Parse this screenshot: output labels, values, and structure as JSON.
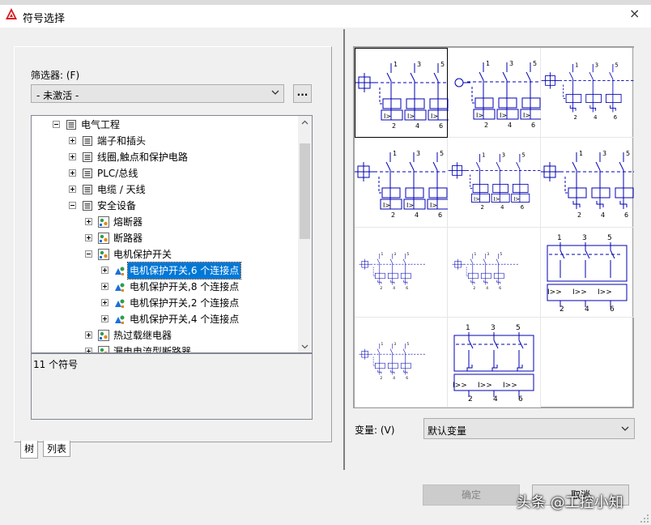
{
  "window": {
    "title": "符号选择",
    "close_label": "×"
  },
  "filter": {
    "label": "筛选器: (F)",
    "value": "- 未激活 -",
    "browse_label": "..."
  },
  "tree": {
    "items": [
      {
        "label": "电气工程",
        "level": 1,
        "state": "open",
        "icon": "folder-icon"
      },
      {
        "label": "端子和插头",
        "level": 2,
        "state": "closed",
        "icon": "folder-icon"
      },
      {
        "label": "线圈,触点和保护电路",
        "level": 2,
        "state": "closed",
        "icon": "folder-icon"
      },
      {
        "label": "PLC/总线",
        "level": 2,
        "state": "closed",
        "icon": "folder-icon"
      },
      {
        "label": "电缆 / 天线",
        "level": 2,
        "state": "closed",
        "icon": "folder-icon"
      },
      {
        "label": "安全设备",
        "level": 2,
        "state": "open",
        "icon": "folder-icon"
      },
      {
        "label": "熔断器",
        "level": 3,
        "state": "closed",
        "icon": "symbol-group-icon"
      },
      {
        "label": "断路器",
        "level": 3,
        "state": "closed",
        "icon": "symbol-group-icon"
      },
      {
        "label": "电机保护开关",
        "level": 3,
        "state": "open",
        "icon": "symbol-group-icon"
      },
      {
        "label": "电机保护开关,6 个连接点",
        "level": 4,
        "state": "closed",
        "icon": "symbol-icon",
        "selected": true
      },
      {
        "label": "电机保护开关,8 个连接点",
        "level": 4,
        "state": "closed",
        "icon": "symbol-icon"
      },
      {
        "label": "电机保护开关,2 个连接点",
        "level": 4,
        "state": "closed",
        "icon": "symbol-icon"
      },
      {
        "label": "电机保护开关,4 个连接点",
        "level": 4,
        "state": "closed",
        "icon": "symbol-icon"
      },
      {
        "label": "热过载继电器",
        "level": 3,
        "state": "closed",
        "icon": "symbol-group-icon"
      },
      {
        "label": "漏电电流型断路器",
        "level": 3,
        "state": "closed",
        "icon": "symbol-group-icon"
      }
    ]
  },
  "status": {
    "text": "11 个符号"
  },
  "tabs": [
    {
      "label": "树",
      "active": true
    },
    {
      "label": "列表",
      "active": false
    }
  ],
  "preview": {
    "symbols": [
      {
        "variant": "full",
        "selected": true,
        "terminals_top": [
          "1",
          "3",
          "5"
        ],
        "terminals_bottom": [
          "2",
          "4",
          "6"
        ],
        "trip": "I>"
      },
      {
        "variant": "full-motor",
        "selected": false,
        "terminals_top": [
          "1",
          "3",
          "5"
        ],
        "terminals_bottom": [
          "2",
          "4",
          "6"
        ],
        "trip": "I>"
      },
      {
        "variant": "compact",
        "selected": false,
        "terminals_top": [
          "1",
          "3",
          "5"
        ],
        "terminals_bottom": [
          "2",
          "4",
          "6"
        ],
        "trip": ""
      },
      {
        "variant": "full",
        "selected": false,
        "terminals_top": [
          "1",
          "3",
          "5"
        ],
        "terminals_bottom": [
          "2",
          "4",
          "6"
        ],
        "trip": "I>"
      },
      {
        "variant": "compact",
        "selected": false,
        "terminals_top": [
          "1",
          "3",
          "5"
        ],
        "terminals_bottom": [
          "2",
          "4",
          "6"
        ],
        "trip": "I>"
      },
      {
        "variant": "thermal",
        "selected": false,
        "terminals_top": [
          "1",
          "3",
          "5"
        ],
        "terminals_bottom": [
          "2",
          "4",
          "6"
        ],
        "trip": ""
      },
      {
        "variant": "mini",
        "selected": false,
        "terminals_top": [
          "1",
          "3",
          "5"
        ],
        "terminals_bottom": [
          "2",
          "4",
          "6"
        ],
        "trip": ""
      },
      {
        "variant": "mini",
        "selected": false,
        "terminals_top": [
          "1",
          "3",
          "5"
        ],
        "terminals_bottom": [
          "2",
          "4",
          "6"
        ],
        "trip": ""
      },
      {
        "variant": "large",
        "selected": false,
        "terminals_top": [
          "1",
          "3",
          "5"
        ],
        "terminals_bottom": [
          "2",
          "4",
          "6"
        ],
        "trip": "I>>"
      },
      {
        "variant": "mini-thermal",
        "selected": false,
        "terminals_top": [
          "1",
          "3",
          "5"
        ],
        "terminals_bottom": [
          "2",
          "4",
          "6"
        ],
        "trip": ""
      },
      {
        "variant": "large-thermal",
        "selected": false,
        "terminals_top": [
          "1",
          "3",
          "5"
        ],
        "terminals_bottom": [
          "2",
          "4",
          "6"
        ],
        "trip": "I>>"
      }
    ]
  },
  "variant": {
    "label": "变量: (V)",
    "value": "默认变量"
  },
  "buttons": {
    "ok": "确定",
    "cancel": "取消"
  },
  "watermark": "头条 @工控小知",
  "colors": {
    "symbol_blue": "#0000b4",
    "selection": "#0078d7"
  }
}
